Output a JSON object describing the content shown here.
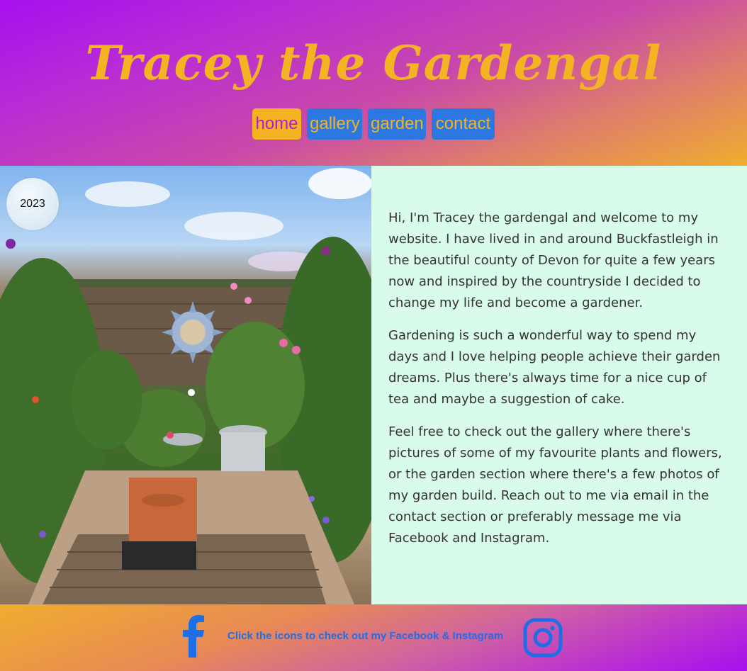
{
  "header": {
    "title": "Tracey the Gardengal",
    "nav": [
      {
        "label": "home",
        "active": true
      },
      {
        "label": "gallery",
        "active": false
      },
      {
        "label": "garden",
        "active": false
      },
      {
        "label": "contact",
        "active": false
      }
    ]
  },
  "hero": {
    "year_badge": "2023"
  },
  "content": {
    "paragraphs": [
      "Hi, I'm Tracey the gardengal and welcome to my website. I have lived in and around Buckfastleigh in the beautiful county of Devon for quite a few years now and inspired by the countryside I decided to change my life and become a gardener.",
      "Gardening is such a wonderful way to spend my days and I love helping people achieve their garden dreams. Plus there's always time for a nice cup of tea and maybe a suggestion of cake.",
      "Feel free to check out the gallery where there's pictures of some of my favourite plants and flowers, or the garden section where there's a few photos of my garden build. Reach out to me via email in the contact section or preferably message me via Facebook and Instagram."
    ]
  },
  "footer": {
    "text": "Click the icons to check out my Facebook & Instagram",
    "facebook_icon": "facebook-icon",
    "instagram_icon": "instagram-icon"
  },
  "colors": {
    "title": "#f3b323",
    "nav_bg": "#2d78e0",
    "nav_active_bg": "#f3b323",
    "content_bg": "#d9fbe9",
    "footer_link": "#1e6fe6"
  }
}
